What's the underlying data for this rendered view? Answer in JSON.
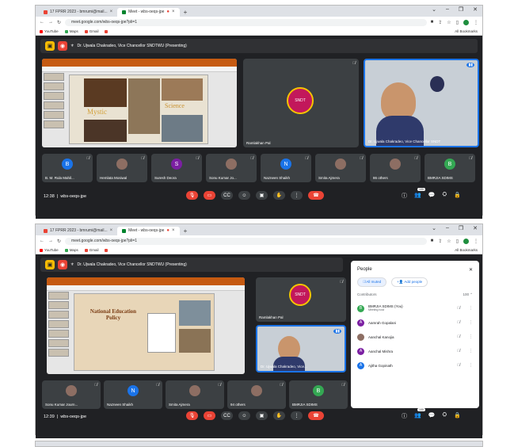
{
  "tabs": {
    "tab1": "17 FPRR 2023 - bmrumi@mail...",
    "tab2": "Meet - wbs-oeqs-jpe",
    "new": "+"
  },
  "address": {
    "url": "meet.google.com/wbs-oeqs-jpe?pli=1",
    "url2": "meet.google.com/wbs-oeqs-jpe?pli=1"
  },
  "bookmarks": {
    "youtube": "YouTube",
    "maps": "Maps",
    "gmail": "Gmail",
    "all": "All Bookmarks"
  },
  "presenter": "Dr. Ujwala Chakradeo, Vice Chancellor SNDTWU (Presenting)",
  "shot1": {
    "slide_word1": "Mystic",
    "slide_word2": "Science",
    "tile_ramlakhan": "Ramlakhan Pal",
    "tile_presenter": "Dr. Ujwala Chakradeo, Vice Chancellor SNDT",
    "strip": [
      {
        "name": "B. M. Rula Mahil...",
        "initial": "B",
        "color": "#1a73e8"
      },
      {
        "name": "Hemlata Mosiwal",
        "initial": "",
        "color": "#3c4043"
      },
      {
        "name": "Suresh Deora",
        "initial": "S",
        "color": "#7b1fa2"
      },
      {
        "name": "Sonu Kumar Jo...",
        "initial": "",
        "color": "#3c4043"
      },
      {
        "name": "Nazneen Shaikh",
        "initial": "N",
        "color": "#1a73e8"
      },
      {
        "name": "Smita Ajmera",
        "initial": "",
        "color": "#3c4043"
      },
      {
        "name": "86 others",
        "initial": "",
        "color": "#3c4043"
      },
      {
        "name": "BMRJIA SDIMS",
        "initial": "B",
        "color": "#34a853"
      }
    ],
    "time": "12:38",
    "code": "wbs-oeqs-jpe",
    "count": "100"
  },
  "shot2": {
    "slide_title": "National Education Policy",
    "tile_ramlakhan": "Ramlakhan Pal",
    "tile_presenter": "Dr. Ujwala Chakradeo, Vice...",
    "strip": [
      {
        "name": "Sonu Kumar Journ...",
        "initial": "",
        "color": "#3c4043"
      },
      {
        "name": "Nazneen Shaikh",
        "initial": "N",
        "color": "#1a73e8"
      },
      {
        "name": "Smita Ajmera",
        "initial": "",
        "color": "#3c4043"
      },
      {
        "name": "94 others",
        "initial": "",
        "color": "#3c4043"
      },
      {
        "name": "BMRJIA SDIMS",
        "initial": "B",
        "color": "#34a853"
      }
    ],
    "time": "12:39",
    "code": "wbs-oeqs-jpe",
    "count": "100"
  },
  "people": {
    "title": "People",
    "all_muted": "All muted",
    "add_people": "Add people",
    "contributors": "Contributors",
    "contributors_count": "100",
    "rows": [
      {
        "name": "BMRJIA SDIMS (You)",
        "sub": "Meeting host",
        "initial": "B",
        "color": "#34a853"
      },
      {
        "name": "Aamrah Gopalani",
        "sub": "",
        "initial": "A",
        "color": "#7b1fa2"
      },
      {
        "name": "Aanchal Kanojia",
        "sub": "",
        "initial": "",
        "color": "#8d6e63"
      },
      {
        "name": "Aanchal Mishra",
        "sub": "",
        "initial": "A",
        "color": "#7b1fa2"
      },
      {
        "name": "Ajitha Gopinath",
        "sub": "",
        "initial": "A",
        "color": "#1a73e8"
      }
    ]
  }
}
